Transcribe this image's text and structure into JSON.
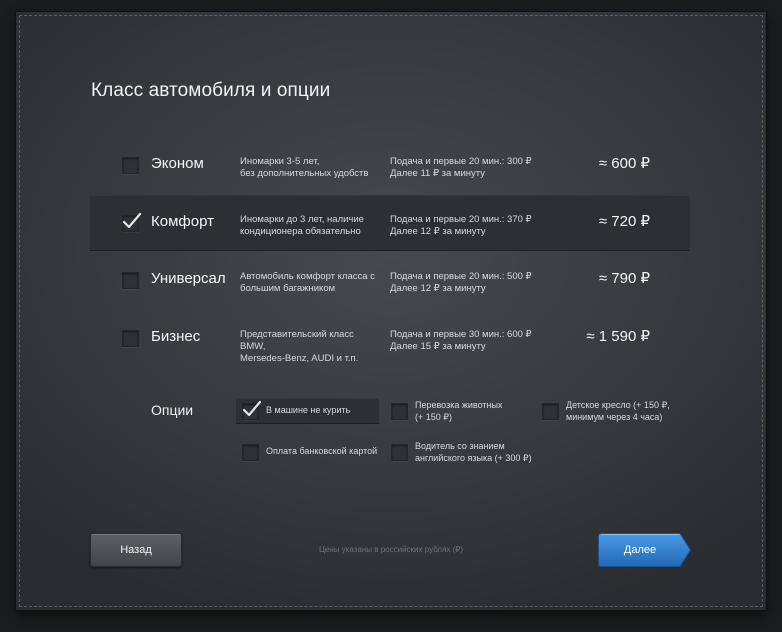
{
  "title": "Класс автомобиля и опции",
  "classes": [
    {
      "name": "Эконом",
      "desc_1": "Иномарки 3-5 лет,",
      "desc_2": "без дополнительных удобств",
      "cond_1": "Подача и первые 20 мин.: 300 ₽",
      "cond_2": "Далее 11 ₽ за минуту",
      "price": "≈ 600 ₽",
      "selected": false
    },
    {
      "name": "Комфорт",
      "desc_1": "Иномарки до 3 лет, наличие",
      "desc_2": "кондиционера обязательно",
      "cond_1": "Подача и первые 20 мин.: 370 ₽",
      "cond_2": "Далее 12 ₽ за минуту",
      "price": "≈ 720 ₽",
      "selected": true
    },
    {
      "name": "Универсал",
      "desc_1": "Автомобиль комфорт класса с",
      "desc_2": "большим багажником",
      "cond_1": "Подача и первые 20 мин.: 500 ₽",
      "cond_2": "Далее 12 ₽ за минуту",
      "price": "≈ 790 ₽",
      "selected": false
    },
    {
      "name": "Бизнес",
      "desc_1": "Представительский класс BMW,",
      "desc_2": "Mersedes-Benz, AUDI и т.п.",
      "cond_1": "Подача и первые 30 мин.: 600 ₽",
      "cond_2": "Далее 15 ₽ за минуту",
      "price": "≈ 1 590 ₽",
      "selected": false
    }
  ],
  "options": {
    "label": "Опции",
    "no_smoking": {
      "line_1": "В машине не курить",
      "checked": true
    },
    "pets": {
      "line_1": "Перевозка животных",
      "line_2": "(+ 150 ₽)",
      "checked": false
    },
    "child_seat": {
      "line_1": "Детское кресло (+ 150 ₽,",
      "line_2": "минимум через 4 часа)",
      "checked": false
    },
    "card_payment": {
      "line_1": "Оплата банковской картой",
      "checked": false
    },
    "english_driver": {
      "line_1": "Водитель со знанием",
      "line_2": "английского языка (+ 300 ₽)",
      "checked": false
    }
  },
  "footer": {
    "back_label": "Назад",
    "note": "Цены указаны в российских рублях (₽)",
    "next_label": "Далее"
  },
  "colors": {
    "accent": "#2f7ed0",
    "panel": "#3a3e42",
    "check": "#e6e8ea"
  },
  "icons": {
    "checkmark": "check-icon"
  }
}
